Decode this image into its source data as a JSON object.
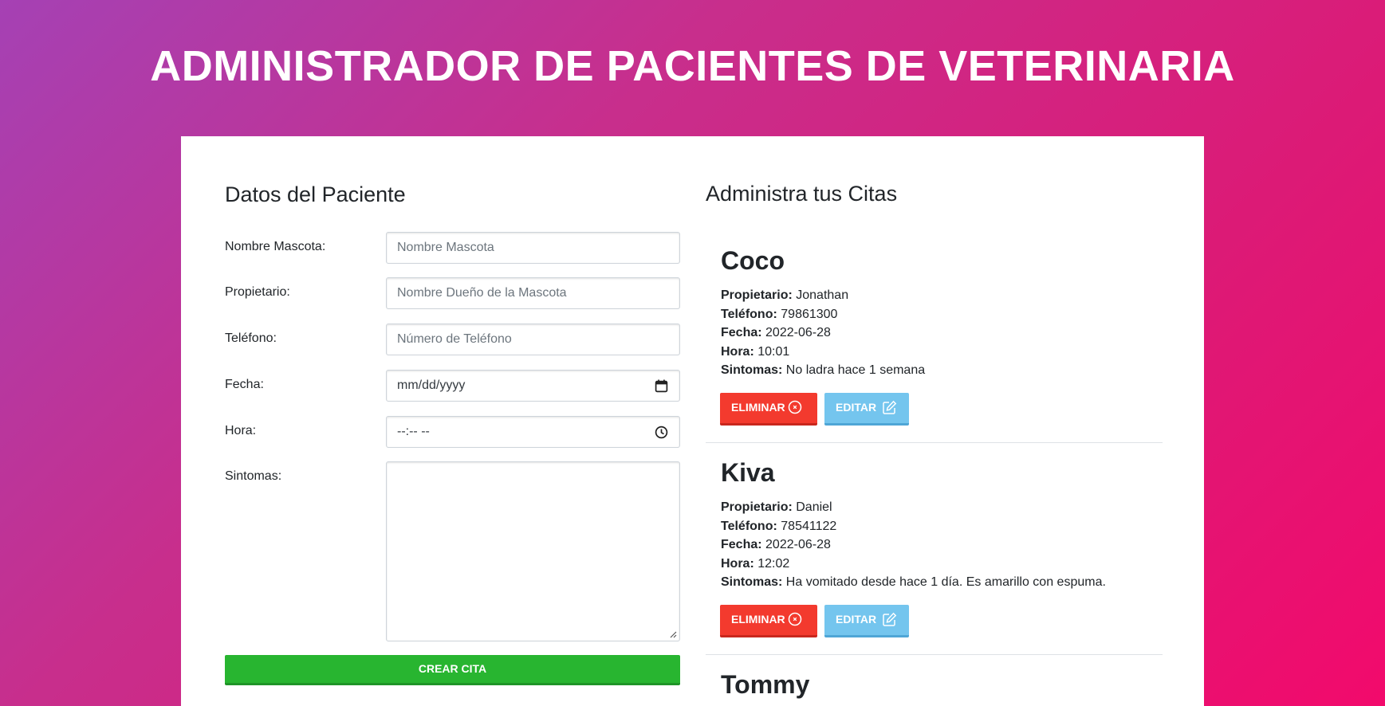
{
  "header": {
    "title": "ADMINISTRADOR DE PACIENTES DE VETERINARIA"
  },
  "form": {
    "title": "Datos del Paciente",
    "fields": {
      "mascota": {
        "label": "Nombre Mascota:",
        "placeholder": "Nombre Mascota"
      },
      "propietario": {
        "label": "Propietario:",
        "placeholder": "Nombre Dueño de la Mascota"
      },
      "telefono": {
        "label": "Teléfono:",
        "placeholder": "Número de Teléfono"
      },
      "fecha": {
        "label": "Fecha:",
        "placeholder": "mm/dd/yyyy"
      },
      "hora": {
        "label": "Hora:",
        "placeholder": "--:-- --"
      },
      "sintomas": {
        "label": "Sintomas:",
        "value": ""
      }
    },
    "submit_label": "CREAR CITA"
  },
  "citas": {
    "title": "Administra tus Citas",
    "field_labels": {
      "propietario": "Propietario:",
      "telefono": "Teléfono:",
      "fecha": "Fecha:",
      "hora": "Hora:",
      "sintomas": "Sintomas:"
    },
    "delete_label": "ELIMINAR",
    "edit_label": "EDITAR",
    "items": [
      {
        "mascota": "Coco",
        "propietario": "Jonathan",
        "telefono": "79861300",
        "fecha": "2022-06-28",
        "hora": "10:01",
        "sintomas": "No ladra hace 1 semana"
      },
      {
        "mascota": "Kiva",
        "propietario": "Daniel",
        "telefono": "78541122",
        "fecha": "2022-06-28",
        "hora": "12:02",
        "sintomas": "Ha vomitado desde hace 1 día. Es amarillo con espuma."
      },
      {
        "mascota": "Tommy"
      }
    ]
  },
  "colors": {
    "delete": "#f33a2e",
    "edit": "#74c5ee",
    "submit": "#28b530"
  },
  "icons": {
    "calendar": "calendar-icon",
    "clock": "clock-icon",
    "delete": "x-circle-icon",
    "edit": "edit-icon"
  }
}
